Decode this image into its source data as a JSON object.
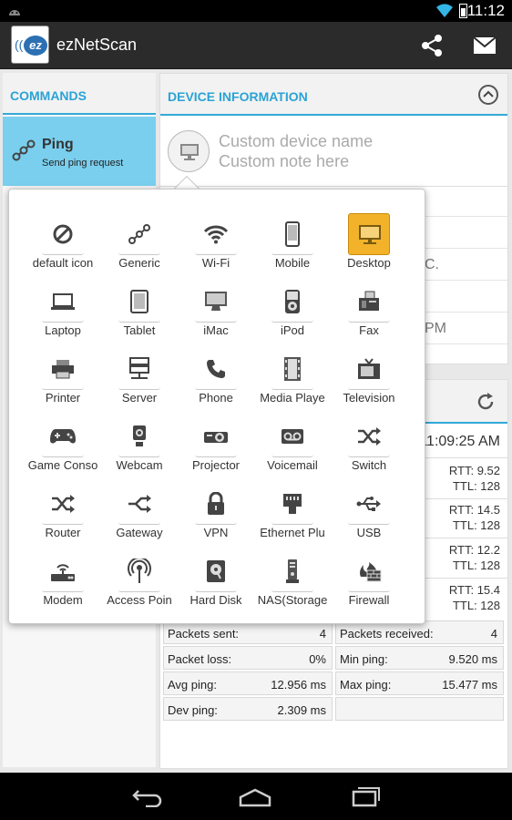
{
  "status_bar": {
    "time": "11:12"
  },
  "app": {
    "title": "ezNetScan",
    "logo_text": "ez"
  },
  "commands": {
    "header": "COMMANDS",
    "selected": {
      "title": "Ping",
      "subtitle": "Send ping request"
    }
  },
  "device": {
    "header": "DEVICE INFORMATION",
    "name_placeholder": "Custom device name",
    "note_placeholder": "Custom note here",
    "partial_values": [
      "C.",
      "PM"
    ]
  },
  "ping": {
    "timestamp_fragment": "11:09:25 AM",
    "replies": [
      {
        "rtt": "RTT:  9.52",
        "ttl": "TTL:  128"
      },
      {
        "rtt": "RTT:  14.5",
        "ttl": "TTL:  128"
      },
      {
        "rtt": "RTT:  12.2",
        "ttl": "TTL:  128"
      },
      {
        "rtt": "RTT:  15.4",
        "ttl": "TTL:  128"
      }
    ],
    "stats": [
      {
        "label": "Packets sent:",
        "value": "4"
      },
      {
        "label": "Packets received:",
        "value": "4"
      },
      {
        "label": "Packet loss:",
        "value": "0%"
      },
      {
        "label": "Min ping:",
        "value": "9.520 ms"
      },
      {
        "label": "Avg ping:",
        "value": "12.956 ms"
      },
      {
        "label": "Max ping:",
        "value": "15.477 ms"
      },
      {
        "label": "Dev ping:",
        "value": "2.309 ms"
      },
      {
        "label": "",
        "value": ""
      }
    ]
  },
  "icon_picker": {
    "selected": "Desktop",
    "items": [
      {
        "label": "default icon",
        "icon": "block-icon"
      },
      {
        "label": "Generic",
        "icon": "generic-icon"
      },
      {
        "label": "Wi-Fi",
        "icon": "wifi-icon"
      },
      {
        "label": "Mobile",
        "icon": "mobile-icon"
      },
      {
        "label": "Desktop",
        "icon": "desktop-icon"
      },
      {
        "label": "Laptop",
        "icon": "laptop-icon"
      },
      {
        "label": "Tablet",
        "icon": "tablet-icon"
      },
      {
        "label": "iMac",
        "icon": "imac-icon"
      },
      {
        "label": "iPod",
        "icon": "ipod-icon"
      },
      {
        "label": "Fax",
        "icon": "fax-icon"
      },
      {
        "label": "Printer",
        "icon": "printer-icon"
      },
      {
        "label": "Server",
        "icon": "server-icon"
      },
      {
        "label": "Phone",
        "icon": "phone-icon"
      },
      {
        "label": "Media Playe",
        "icon": "film-icon"
      },
      {
        "label": "Television",
        "icon": "tv-icon"
      },
      {
        "label": "Game Conso",
        "icon": "gamepad-icon"
      },
      {
        "label": "Webcam",
        "icon": "webcam-icon"
      },
      {
        "label": "Projector",
        "icon": "projector-icon"
      },
      {
        "label": "Voicemail",
        "icon": "voicemail-icon"
      },
      {
        "label": "Switch",
        "icon": "switch-icon"
      },
      {
        "label": "Router",
        "icon": "router-icon"
      },
      {
        "label": "Gateway",
        "icon": "gateway-icon"
      },
      {
        "label": "VPN",
        "icon": "lock-icon"
      },
      {
        "label": "Ethernet Plu",
        "icon": "ethernet-icon"
      },
      {
        "label": "USB",
        "icon": "usb-icon"
      },
      {
        "label": "Modem",
        "icon": "modem-icon"
      },
      {
        "label": "Access Poin",
        "icon": "access-point-icon"
      },
      {
        "label": "Hard Disk",
        "icon": "hard-disk-icon"
      },
      {
        "label": "NAS(Storage",
        "icon": "nas-icon"
      },
      {
        "label": "Firewall",
        "icon": "firewall-icon"
      }
    ]
  },
  "colors": {
    "accent": "#33a9d8",
    "selected_cmd": "#7acfee",
    "selected_icon": "#f2b32a"
  }
}
